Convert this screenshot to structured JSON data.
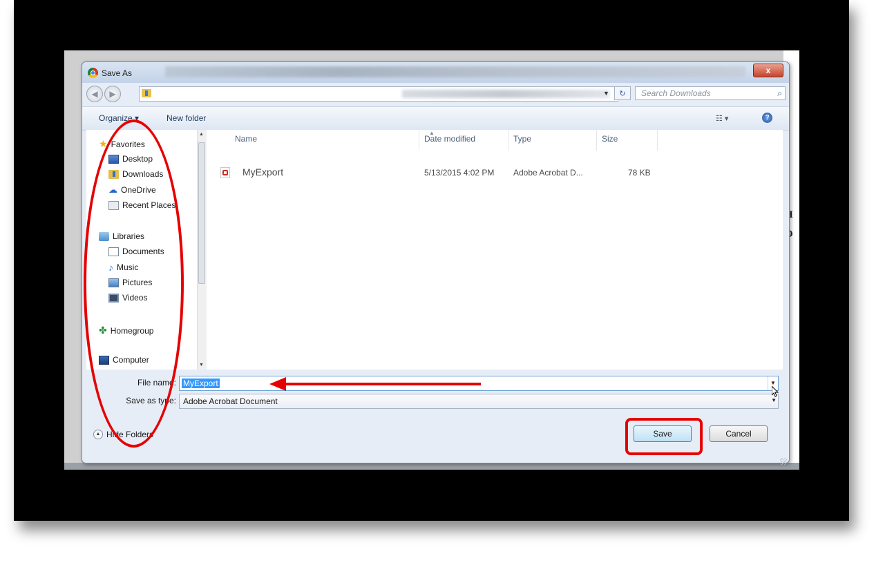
{
  "dialog": {
    "title": "Save As",
    "close_glyph": "x"
  },
  "addressbar": {
    "back_glyph": "◀",
    "forward_glyph": "▶",
    "refresh_glyph": "↻",
    "search_placeholder": "Search Downloads"
  },
  "toolbar": {
    "organize": "Organize ▾",
    "new_folder": "New folder"
  },
  "navigation": {
    "favorites": "Favorites",
    "desktop": "Desktop",
    "downloads": "Downloads",
    "onedrive": "OneDrive",
    "recent_places": "Recent Places",
    "libraries": "Libraries",
    "documents": "Documents",
    "music": "Music",
    "pictures": "Pictures",
    "videos": "Videos",
    "homegroup": "Homegroup",
    "computer": "Computer"
  },
  "columns": {
    "name": "Name",
    "date_modified": "Date modified",
    "type": "Type",
    "size": "Size"
  },
  "files": [
    {
      "name": "MyExport",
      "date": "5/13/2015 4:02 PM",
      "type": "Adobe Acrobat D...",
      "size": "78 KB"
    }
  ],
  "form": {
    "file_name_label": "File name:",
    "file_name_value": "MyExport",
    "save_as_type_label": "Save as type:",
    "save_as_type_value": "Adobe Acrobat Document",
    "hide_folders": "Hide Folders",
    "save": "Save",
    "cancel": "Cancel"
  },
  "annotations": {
    "color": "#e60000"
  }
}
